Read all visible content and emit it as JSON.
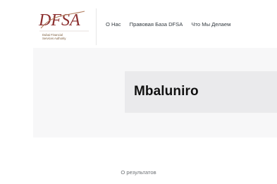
{
  "logo": {
    "mark": "DFSA",
    "subtitle_line1": "Dubai Financial",
    "subtitle_line2": "Services Authority",
    "colors": {
      "accent": "#8b2e2e",
      "text": "#7a5a3a"
    }
  },
  "nav": {
    "items": [
      {
        "label": "О Нас"
      },
      {
        "label": "Правовая База DFSA"
      },
      {
        "label": "Что Мы Делаем"
      }
    ]
  },
  "search": {
    "query": "Mbaluniro"
  },
  "results": {
    "label": "О результатов"
  },
  "colors": {
    "hero_bg": "#f7f7f8",
    "card_bg": "#eaeaec"
  }
}
